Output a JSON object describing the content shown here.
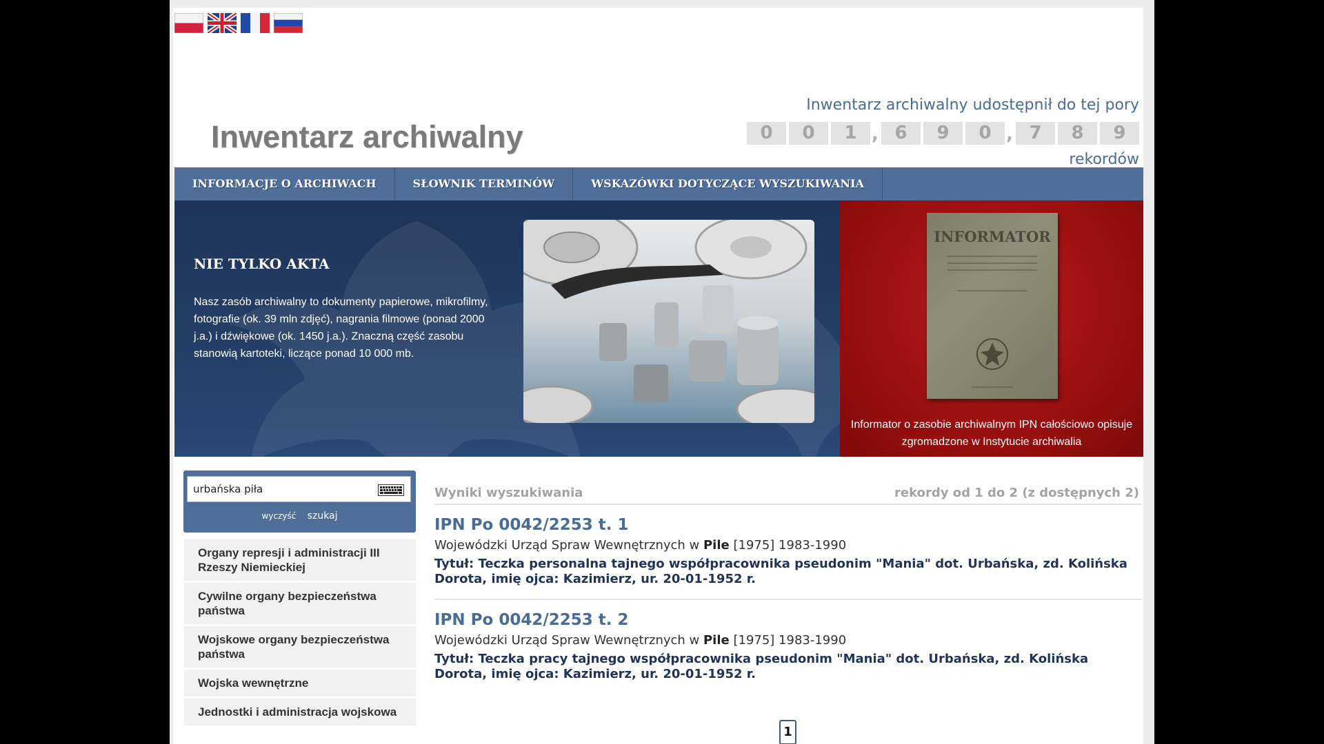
{
  "flags": [
    {
      "name": "pl-flag-icon",
      "lang": "polski"
    },
    {
      "name": "gb-flag-icon",
      "lang": "english"
    },
    {
      "name": "fr-flag-icon",
      "lang": "français"
    },
    {
      "name": "ru-flag-icon",
      "lang": "русский"
    }
  ],
  "header": {
    "title": "Inwentarz archiwalny",
    "counter_caption": "Inwentarz archiwalny udostępnił do tej pory",
    "counter_digits": [
      "0",
      "0",
      "1",
      ",",
      "6",
      "9",
      "0",
      ",",
      "7",
      "8",
      "9"
    ],
    "counter_suffix": "rekordów"
  },
  "nav": {
    "items": [
      "INFORMACJE O ARCHIWACH",
      "SŁOWNIK TERMINÓW",
      "WSKAZÓWKI DOTYCZĄCE WYSZUKIWANIA"
    ]
  },
  "banner": {
    "heading": "NIE TYLKO AKTA",
    "text": "Nasz zasób archiwalny to dokumenty papierowe, mikrofilmy, fotografie (ok. 39 mln zdjęć), nagrania filmowe (ponad 2000 j.a.) i dźwiękowe (ok. 1450 j.a.). Znaczną część zasobu stanowią kartoteki, liczące ponad 10 000 mb.",
    "book_title": "INFORMATOR",
    "caption": "Informator o zasobie archiwalnym IPN całościowo opisuje zgromadzone w Instytucie archiwalia"
  },
  "search": {
    "value": "urbańska piła",
    "clear_label": "wyczyść",
    "submit_label": "szukaj"
  },
  "categories": [
    "Organy represji i administracji III Rzeszy Niemieckiej",
    "Cywilne organy bezpieczeństwa państwa",
    "Wojskowe organy bezpieczeństwa państwa",
    "Wojska wewnętrzne",
    "Jednostki i administracja wojskowa"
  ],
  "results": {
    "title": "Wyniki wyszukiwania",
    "range": "rekordy od 1 do 2 (z dostępnych 2)",
    "items": [
      {
        "signature": "IPN Po 0042/2253 t. 1",
        "creator": "Wojewódzki Urząd Spraw Wewnętrznych w",
        "place": "Pile",
        "dates": "[1975] 1983-1990",
        "title": "Tytuł: Teczka personalna tajnego współpracownika pseudonim \"Mania\" dot. Urbańska, zd. Kolińska Dorota, imię ojca: Kazimierz, ur. 20-01-1952 r."
      },
      {
        "signature": "IPN Po 0042/2253 t. 2",
        "creator": "Wojewódzki Urząd Spraw Wewnętrznych w",
        "place": "Pile",
        "dates": "[1975] 1983-1990",
        "title": "Tytuł: Teczka pracy tajnego współpracownika pseudonim \"Mania\" dot. Urbańska, zd. Kolińska Dorota, imię ojca: Kazimierz, ur. 20-01-1952 r."
      }
    ]
  },
  "pager": {
    "current": "1"
  },
  "colors": {
    "nav": "#4f6f9a",
    "banner_dark": "#1e3458",
    "banner_red": "#9c1010",
    "link": "#4a6b94"
  }
}
